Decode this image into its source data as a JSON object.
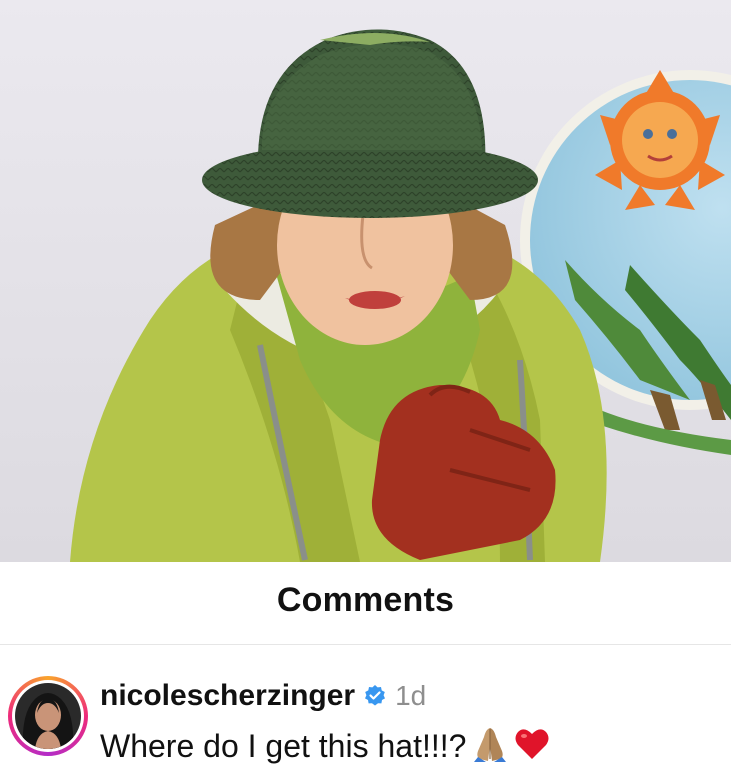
{
  "header": {
    "title": "Comments"
  },
  "comment": {
    "username": "nicolescherzinger",
    "verified": true,
    "timestamp": "1d",
    "text": "Where do I get this hat!!!?",
    "emojis": [
      "folded-hands-emoji",
      "red-heart-emoji"
    ]
  },
  "colors": {
    "background": "#ffffff",
    "verified_badge": "#3897f0",
    "story_ring": [
      "#f9a42c",
      "#ee2a7b",
      "#b32cc8"
    ],
    "jacket": "#b4c54a",
    "hat": "#3e5a3a",
    "gloves": "#a3301f"
  }
}
